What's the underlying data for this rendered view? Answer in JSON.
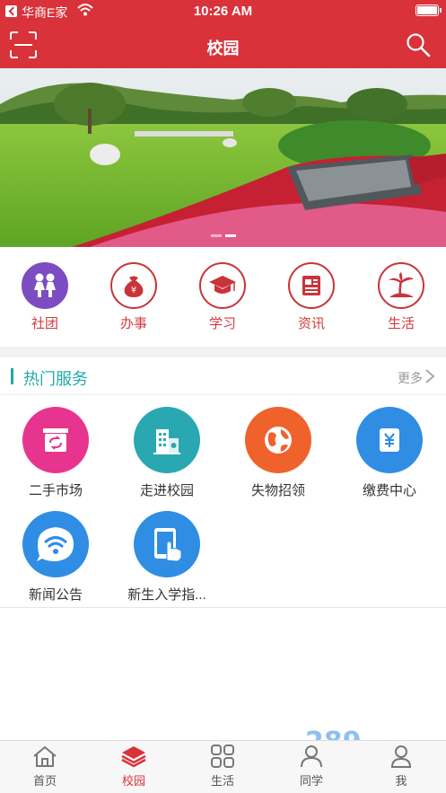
{
  "status_bar": {
    "carrier": "华商E家",
    "time": "10:26 AM"
  },
  "header": {
    "title": "校园"
  },
  "banner": {
    "slide_count": 2,
    "active_slide": 2
  },
  "quick_menu": [
    {
      "label": "社团",
      "icon": "kids-icon"
    },
    {
      "label": "办事",
      "icon": "money-bag-icon"
    },
    {
      "label": "学习",
      "icon": "graduation-cap-icon"
    },
    {
      "label": "资讯",
      "icon": "news-icon"
    },
    {
      "label": "生活",
      "icon": "palm-tree-icon"
    }
  ],
  "hot_services": {
    "title": "热门服务",
    "more_label": "更多",
    "items": [
      {
        "label": "二手市场",
        "icon": "shop-icon",
        "color": "#e7348e"
      },
      {
        "label": "走进校园",
        "icon": "building-icon",
        "color": "#2aa8b1"
      },
      {
        "label": "失物招领",
        "icon": "globe-icon",
        "color": "#f0622c"
      },
      {
        "label": "缴费中心",
        "icon": "yen-card-icon",
        "color": "#2f8de4"
      },
      {
        "label": "新闻公告",
        "icon": "wifi-icon",
        "color": "#2f8de4"
      },
      {
        "label": "新生入学指...",
        "icon": "tablet-touch-icon",
        "color": "#2f8de4"
      }
    ]
  },
  "tab_bar": [
    {
      "label": "首页",
      "icon": "home-icon",
      "active": false
    },
    {
      "label": "校园",
      "icon": "layers-icon",
      "active": true
    },
    {
      "label": "生活",
      "icon": "grid-icon",
      "active": false
    },
    {
      "label": "同学",
      "icon": "classmates-icon",
      "active": false
    },
    {
      "label": "我",
      "icon": "profile-icon",
      "active": false
    }
  ],
  "colors": {
    "primary": "#d9323a",
    "accent": "#20aaa6",
    "separator": "#f2f2f2"
  }
}
